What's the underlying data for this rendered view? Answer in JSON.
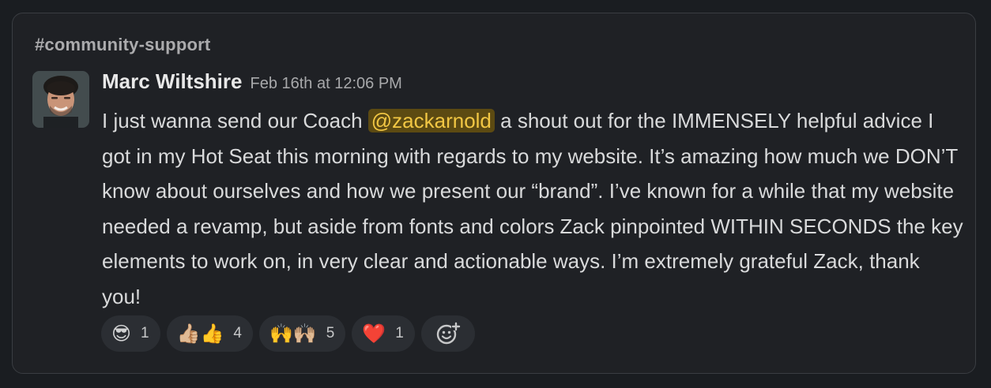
{
  "channel": "#community-support",
  "message": {
    "author": "Marc Wiltshire",
    "timestamp": "Feb 16th at 12:06 PM",
    "text_before": "I just wanna send our Coach ",
    "mention": "@zackarnold",
    "text_after": " a shout out for the IMMENSELY helpful advice I got in my Hot Seat this morning with regards to my website. It’s amazing how much we DON’T know about ourselves and how we present our “brand”. I’ve known for a while that my website needed a revamp, but aside from fonts and colors Zack pinpointed WITHIN SECONDS the key elements to work on, in very clear and actionable ways. I’m extremely grateful Zack, thank you!"
  },
  "reactions": [
    {
      "emoji": "😎",
      "count": "1"
    },
    {
      "emoji": "👍🏼👍",
      "count": "4"
    },
    {
      "emoji": "🙌🙌🏼",
      "count": "5"
    },
    {
      "emoji": "❤️",
      "count": "1"
    }
  ],
  "add_reaction_icon": "add-reaction-icon",
  "colors": {
    "background": "#1a1d21",
    "card": "#1f2125",
    "mention_bg": "#5c4a12",
    "mention_text": "#f2c744",
    "pill": "#2b2e33"
  }
}
